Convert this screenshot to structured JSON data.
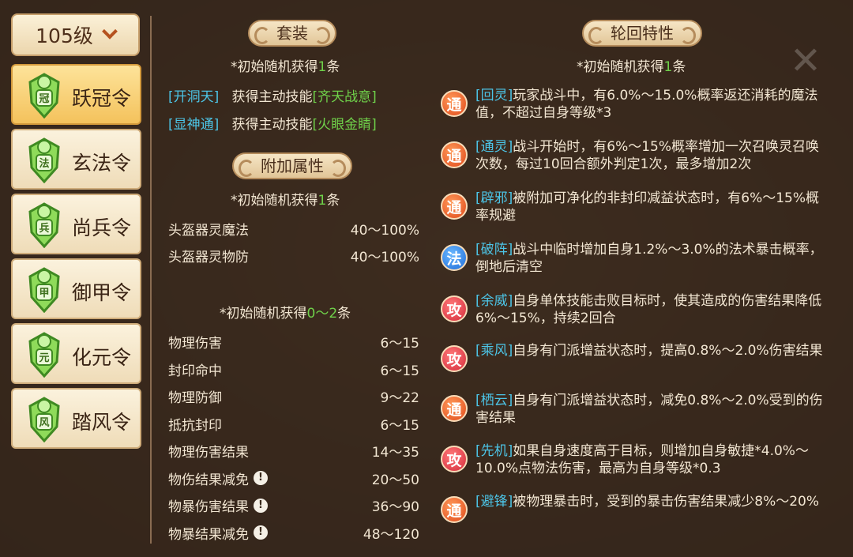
{
  "level_select": {
    "value": "105级",
    "icon": "chevron-down-icon"
  },
  "tokens": [
    {
      "label": "跃冠令",
      "badge": "冠",
      "active": true
    },
    {
      "label": "玄法令",
      "badge": "法",
      "active": false
    },
    {
      "label": "尚兵令",
      "badge": "兵",
      "active": false
    },
    {
      "label": "御甲令",
      "badge": "甲",
      "active": false
    },
    {
      "label": "化元令",
      "badge": "元",
      "active": false
    },
    {
      "label": "踏风令",
      "badge": "风",
      "active": false
    }
  ],
  "set_section": {
    "title": "套装",
    "note_prefix": "*初始随机获得",
    "note_count": "1",
    "note_suffix": "条",
    "items": [
      {
        "tag": "[开洞天]",
        "text": "获得主动技能",
        "skill": "[齐天战意]"
      },
      {
        "tag": "[显神通]",
        "text": "获得主动技能",
        "skill": "[火眼金睛]"
      }
    ]
  },
  "extra_section": {
    "title": "附加属性",
    "note1_prefix": "*初始随机获得",
    "note1_count": "1",
    "note1_suffix": "条",
    "attrs1": [
      {
        "name": "头盔器灵魔法",
        "range": "40～100%"
      },
      {
        "name": "头盔器灵物防",
        "range": "40～100%"
      }
    ],
    "note2_prefix": "*初始随机获得",
    "note2_count": "0～2",
    "note2_suffix": "条",
    "attrs2": [
      {
        "name": "物理伤害",
        "range": "6～15",
        "warn": false
      },
      {
        "name": "封印命中",
        "range": "6～15",
        "warn": false
      },
      {
        "name": "物理防御",
        "range": "9～22",
        "warn": false
      },
      {
        "name": "抵抗封印",
        "range": "6～15",
        "warn": false
      },
      {
        "name": "物理伤害结果",
        "range": "14～35",
        "warn": false
      },
      {
        "name": "物伤结果减免",
        "range": "20～50",
        "warn": true
      },
      {
        "name": "物暴伤害结果",
        "range": "36～90",
        "warn": true
      },
      {
        "name": "物暴结果减免",
        "range": "48～120",
        "warn": true
      }
    ]
  },
  "reincarnation_section": {
    "title": "轮回特性",
    "note_prefix": "*初始随机获得",
    "note_count": "1",
    "note_suffix": "条",
    "traits": [
      {
        "badge": "通",
        "color": "orange",
        "tag": "[回灵]",
        "text": "玩家战斗中，有6.0%～15.0%概率返还消耗的魔法值，不超过自身等级*3"
      },
      {
        "badge": "通",
        "color": "orange",
        "tag": "[通灵]",
        "text": "战斗开始时，有6%～15%概率增加一次召唤灵召唤次数，每过10回合额外判定1次，最多增加2次"
      },
      {
        "badge": "通",
        "color": "orange",
        "tag": "[辟邪]",
        "text": "被附加可净化的非封印减益状态时，有6%～15%概率规避"
      },
      {
        "badge": "法",
        "color": "blue",
        "tag": "[破阵]",
        "text": "战斗中临时增加自身1.2%～3.0%的法术暴击概率，倒地后清空"
      },
      {
        "badge": "攻",
        "color": "red",
        "tag": "[余威]",
        "text": "自身单体技能击败目标时，使其造成的伤害结果降低6%～15%，持续2回合"
      },
      {
        "badge": "攻",
        "color": "red",
        "tag": "[乘风]",
        "text": "自身有门派增益状态时，提高0.8%～2.0%伤害结果"
      },
      {
        "badge": "通",
        "color": "orange",
        "tag": "[栖云]",
        "text": "自身有门派增益状态时，减免0.8%～2.0%受到的伤害结果"
      },
      {
        "badge": "攻",
        "color": "red",
        "tag": "[先机]",
        "text": "如果自身速度高于目标，则增加自身敏捷*4.0%～10.0%点物法伤害，最高为自身等级*0.3"
      },
      {
        "badge": "通",
        "color": "orange",
        "tag": "[避锋]",
        "text": "被物理暴击时，受到的暴击伤害结果减少8%～20%"
      }
    ]
  },
  "colors": {
    "tag": "#4cc4e6",
    "skill": "#6fd14a",
    "count": "#6fd14a"
  }
}
